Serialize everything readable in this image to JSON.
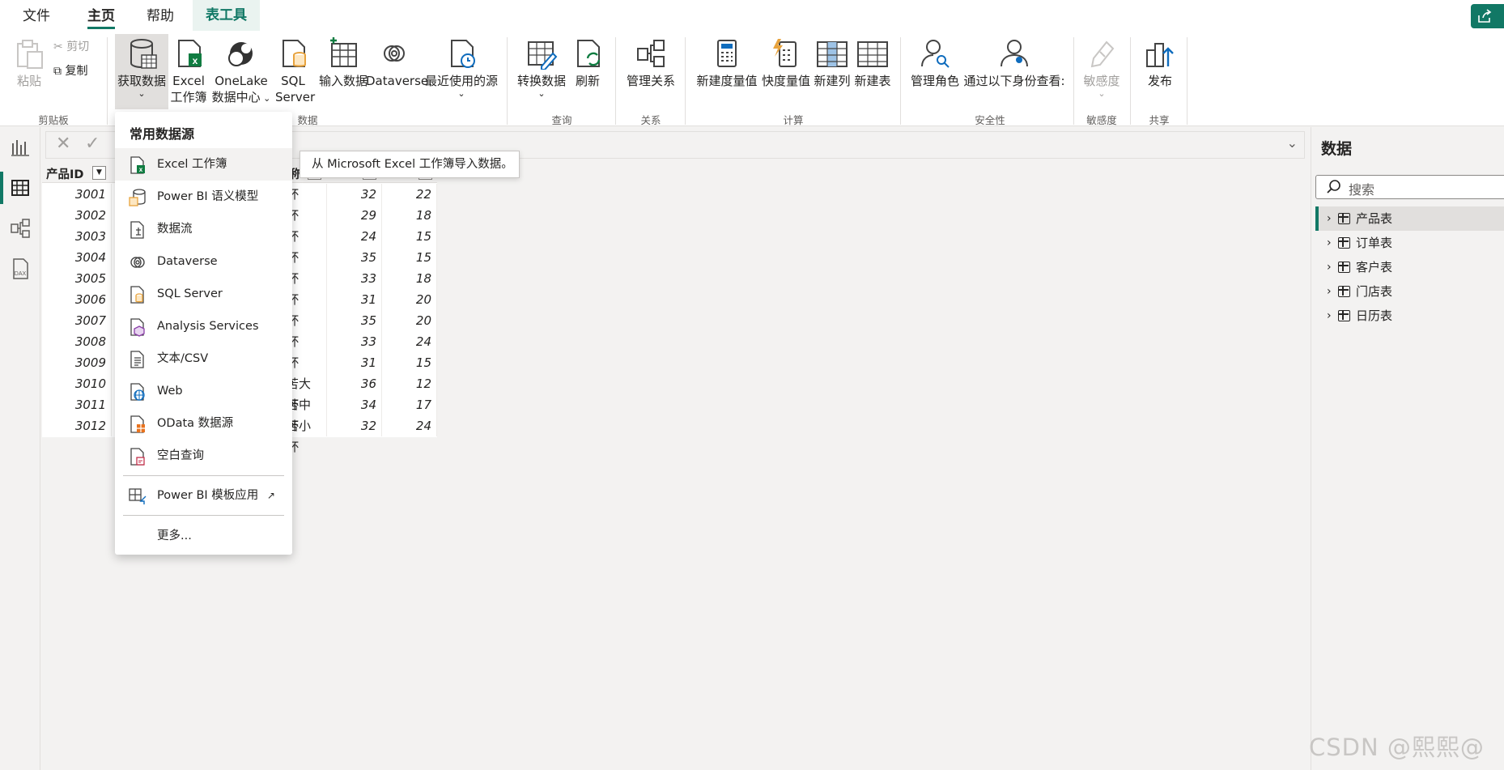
{
  "menu": {
    "tabs": [
      "文件",
      "主页",
      "帮助",
      "表工具"
    ]
  },
  "ribbon": {
    "clipboard": {
      "paste": "粘贴",
      "cut": "剪切",
      "copy": "复制",
      "group": "剪贴板"
    },
    "data": {
      "get_data": "获取数据",
      "excel_line1": "Excel",
      "excel_line2": "工作簿",
      "onelake_line1": "OneLake",
      "onelake_line2": "数据中心",
      "sql_line1": "SQL",
      "sql_line2": "Server",
      "enter_data": "输入数据",
      "dataverse": "Dataverse",
      "recent": "最近使用的源",
      "group": "数据"
    },
    "query": {
      "transform": "转换数据",
      "refresh": "刷新",
      "group": "查询"
    },
    "relations": {
      "manage": "管理关系",
      "group": "关系"
    },
    "calc": {
      "new_measure": "新建度量值",
      "quick_measure": "快度量值",
      "new_column": "新建列",
      "new_table": "新建表",
      "group": "计算"
    },
    "security": {
      "manage_roles": "管理角色",
      "view_as": "通过以下身份查看:",
      "group": "安全性"
    },
    "sensitivity": {
      "label": "敏感度",
      "group": "敏感度"
    },
    "share": {
      "publish": "发布",
      "group": "共享"
    }
  },
  "table": {
    "headers": [
      "产品ID"
    ],
    "partial_header_suffix": "称",
    "rows": [
      {
        "id": "3001",
        "name": "杯",
        "price": "32",
        "cost": "22"
      },
      {
        "id": "3002",
        "name": "杯",
        "price": "29",
        "cost": "18"
      },
      {
        "id": "3003",
        "name": "杯",
        "price": "24",
        "cost": "15"
      },
      {
        "id": "3004",
        "name": "杯",
        "price": "35",
        "cost": "15"
      },
      {
        "id": "3005",
        "name": "杯",
        "price": "33",
        "cost": "18"
      },
      {
        "id": "3006",
        "name": "杯",
        "price": "31",
        "cost": "20"
      },
      {
        "id": "3007",
        "name": "杯",
        "price": "35",
        "cost": "20"
      },
      {
        "id": "3008",
        "name": "杯",
        "price": "33",
        "cost": "24"
      },
      {
        "id": "3009",
        "name": "杯",
        "price": "31",
        "cost": "15"
      },
      {
        "id": "3010",
        "name": "苦大杯",
        "price": "36",
        "cost": "12"
      },
      {
        "id": "3011",
        "name": "苦中杯",
        "price": "34",
        "cost": "17"
      },
      {
        "id": "3012",
        "name": "苦小杯",
        "price": "32",
        "cost": "24"
      }
    ]
  },
  "dropdown": {
    "header": "常用数据源",
    "items": [
      {
        "label": "Excel 工作簿",
        "icon": "excel-icon"
      },
      {
        "label": "Power BI 语义模型",
        "icon": "semantic-model-icon"
      },
      {
        "label": "数据流",
        "icon": "dataflow-icon"
      },
      {
        "label": "Dataverse",
        "icon": "dataverse-icon"
      },
      {
        "label": "SQL Server",
        "icon": "sql-server-icon"
      },
      {
        "label": "Analysis Services",
        "icon": "analysis-services-icon"
      },
      {
        "label": "文本/CSV",
        "icon": "text-csv-icon"
      },
      {
        "label": "Web",
        "icon": "web-icon"
      },
      {
        "label": "OData 数据源",
        "icon": "odata-icon"
      },
      {
        "label": "空白查询",
        "icon": "blank-query-icon"
      }
    ],
    "template_app": "Power BI 模板应用",
    "more": "更多..."
  },
  "tooltip": "从 Microsoft Excel 工作簿导入数据。",
  "datapane": {
    "title": "数据",
    "search_placeholder": "搜索",
    "tables": [
      "产品表",
      "订单表",
      "客户表",
      "门店表",
      "日历表"
    ]
  },
  "watermark": "CSDN @熙熙@"
}
